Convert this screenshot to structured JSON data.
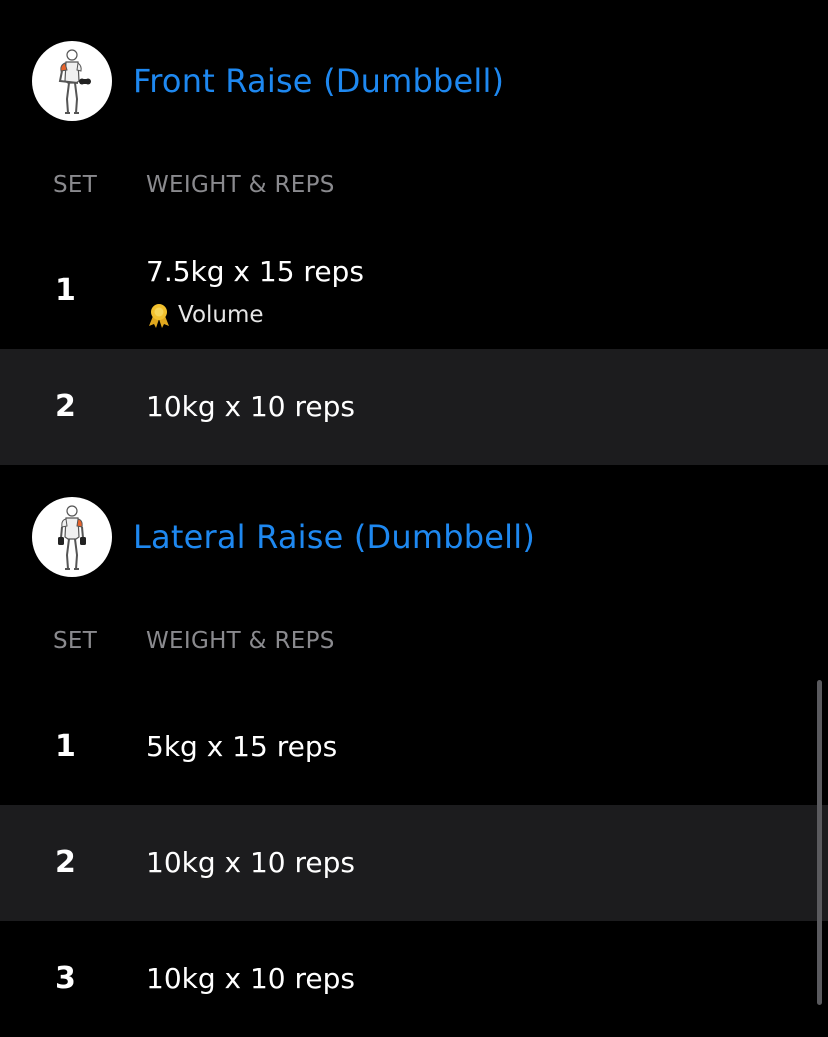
{
  "colors": {
    "title": "#1e88f0",
    "alt_row": "#1c1c1e",
    "header_text": "#8a8a8e",
    "medal": "#f2c12e"
  },
  "column_headers": {
    "set": "SET",
    "weight_reps": "WEIGHT & REPS"
  },
  "exercises": [
    {
      "name": "Front Raise (Dumbbell)",
      "avatar_icon": "front-raise-figure-icon",
      "sets": [
        {
          "num": "1",
          "value": "7.5kg x 15 reps",
          "badge": {
            "icon": "medal-icon",
            "label": "Volume"
          }
        },
        {
          "num": "2",
          "value": "10kg x 10 reps"
        }
      ]
    },
    {
      "name": "Lateral Raise (Dumbbell)",
      "avatar_icon": "lateral-raise-figure-icon",
      "sets": [
        {
          "num": "1",
          "value": "5kg x 15 reps"
        },
        {
          "num": "2",
          "value": "10kg x 10 reps"
        },
        {
          "num": "3",
          "value": "10kg x 10 reps"
        }
      ]
    }
  ]
}
